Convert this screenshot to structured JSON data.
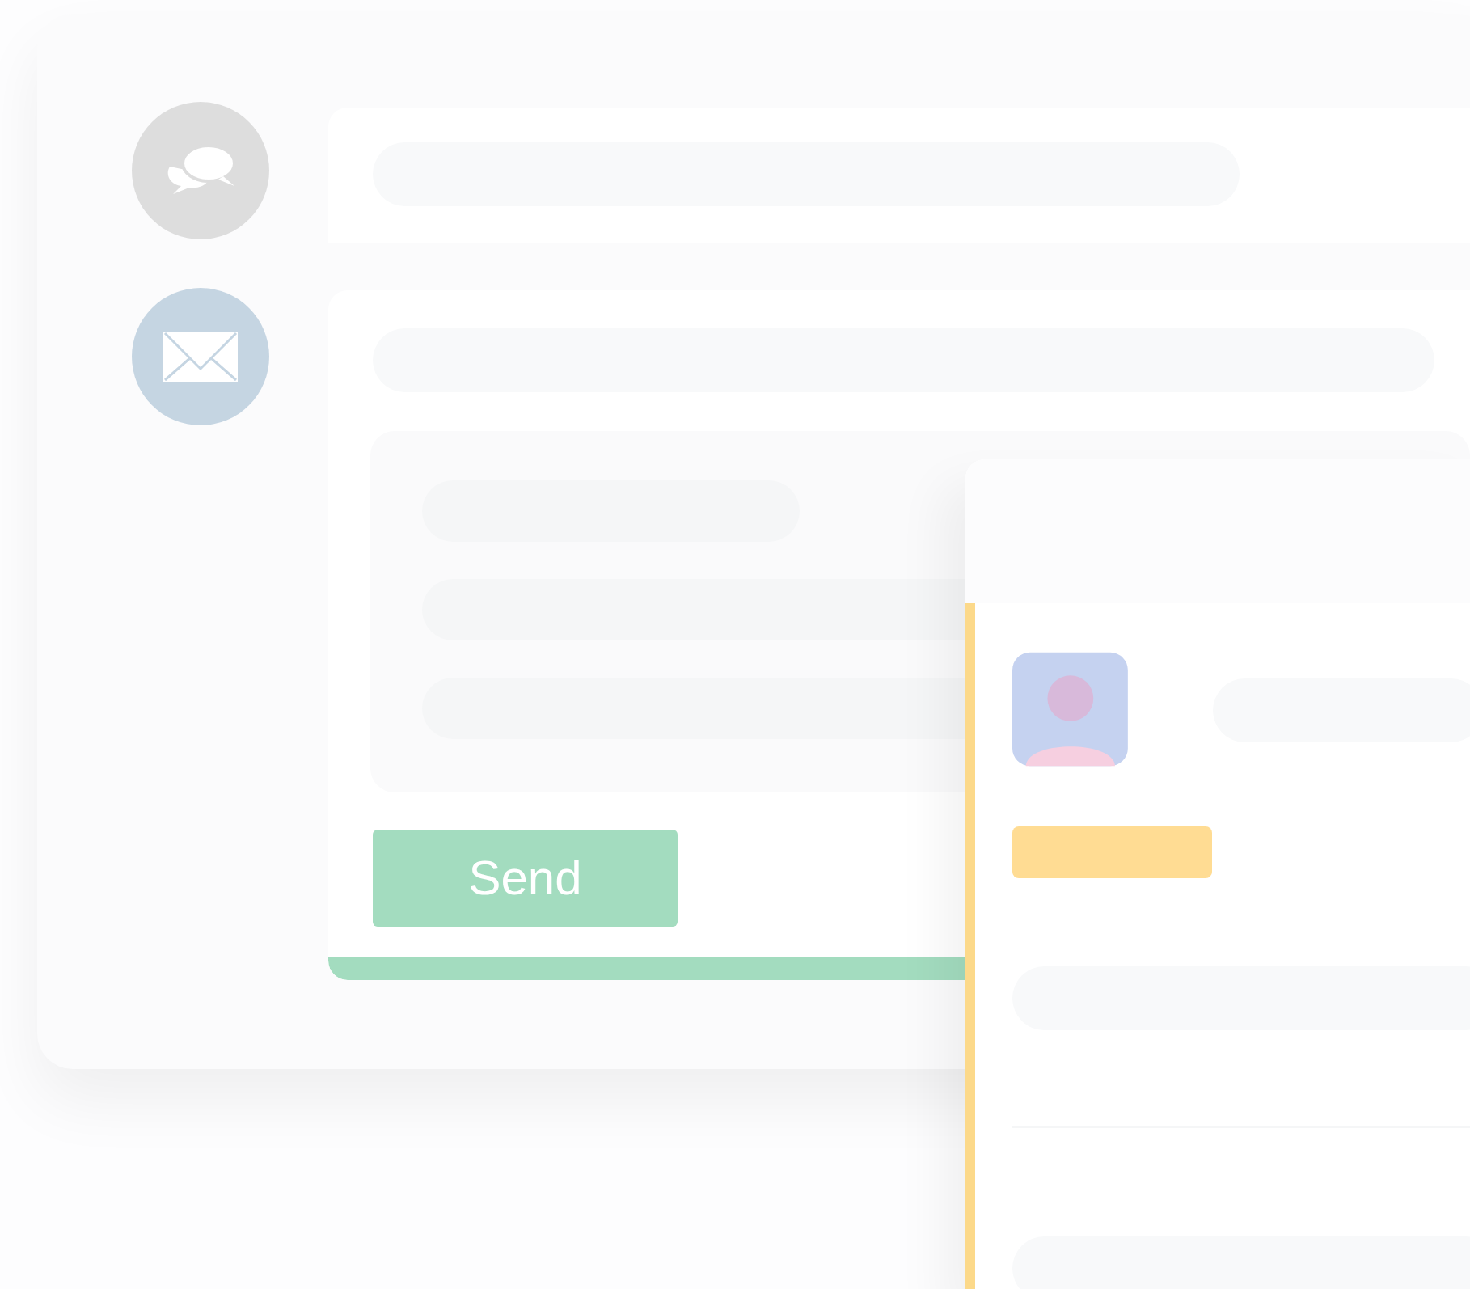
{
  "send_button": {
    "label": "Send"
  }
}
